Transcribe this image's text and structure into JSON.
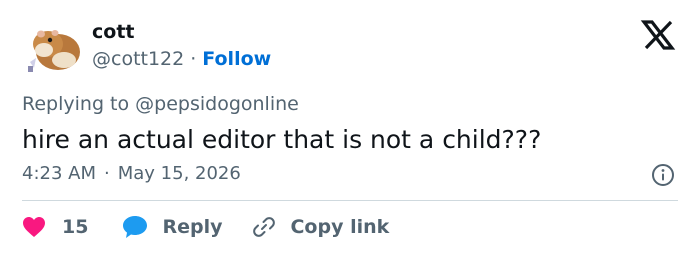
{
  "author": {
    "display_name": "cott",
    "handle": "@cott122",
    "separator": "·",
    "follow_label": "Follow",
    "avatar_icon": "hamster-avatar"
  },
  "reply_context": {
    "prefix": "Replying to ",
    "mention": "@pepsidogonline"
  },
  "tweet": {
    "text": "hire an actual editor that is not a child???",
    "time": "4:23 AM",
    "separator": "·",
    "date": "May 15, 2026"
  },
  "actions": {
    "like_count": "15",
    "reply_label": "Reply",
    "copy_link_label": "Copy link"
  },
  "colors": {
    "accent_blue": "#006fd6",
    "like_red": "#f91880",
    "reply_blue": "#1d9bf0",
    "secondary_text": "#536471",
    "primary_text": "#0f1419",
    "divider": "#cfd9de"
  },
  "icons": {
    "brand": "x-logo-icon",
    "info": "info-icon",
    "like": "heart-icon",
    "reply": "speech-bubble-icon",
    "copy": "link-icon"
  }
}
